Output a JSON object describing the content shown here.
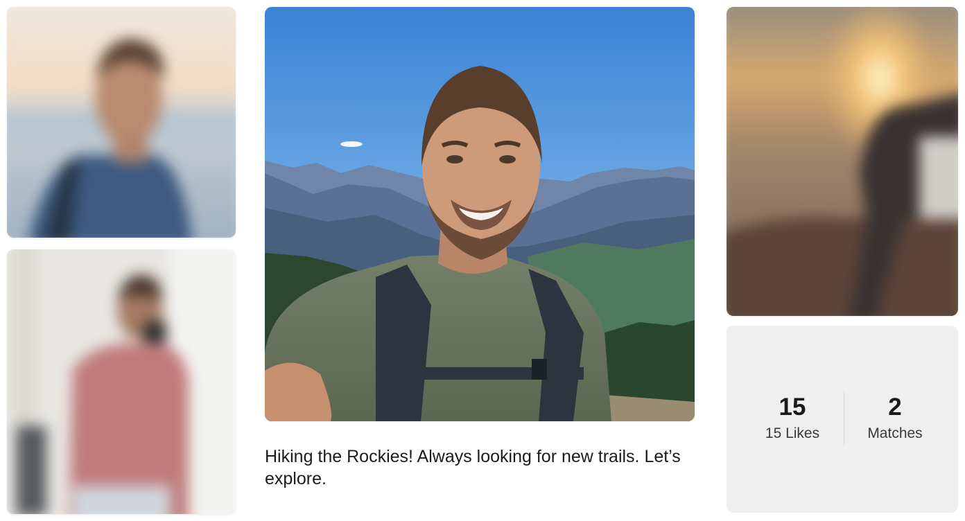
{
  "profile": {
    "bio": "Hiking the Rockies! Always looking for new trails. Let’s explore.",
    "photos": [
      {
        "description": "blurred-portrait-ocean",
        "state": "blurred"
      },
      {
        "description": "blurred-mirror-selfie",
        "state": "blurred"
      },
      {
        "description": "mountain-selfie",
        "state": "main"
      },
      {
        "description": "blurred-sunset-silhouette",
        "state": "blurred"
      }
    ]
  },
  "stats": {
    "likes": {
      "value": "15",
      "label": "15 Likes"
    },
    "matches": {
      "value": "2",
      "label": "Matches"
    }
  },
  "colors": {
    "sky": "#4a8fd8",
    "mountain": "#5c7391",
    "forest": "#2f4a34",
    "shirt": "#6c7858",
    "sunset": "#d99448",
    "stats_bg": "#efefef"
  }
}
